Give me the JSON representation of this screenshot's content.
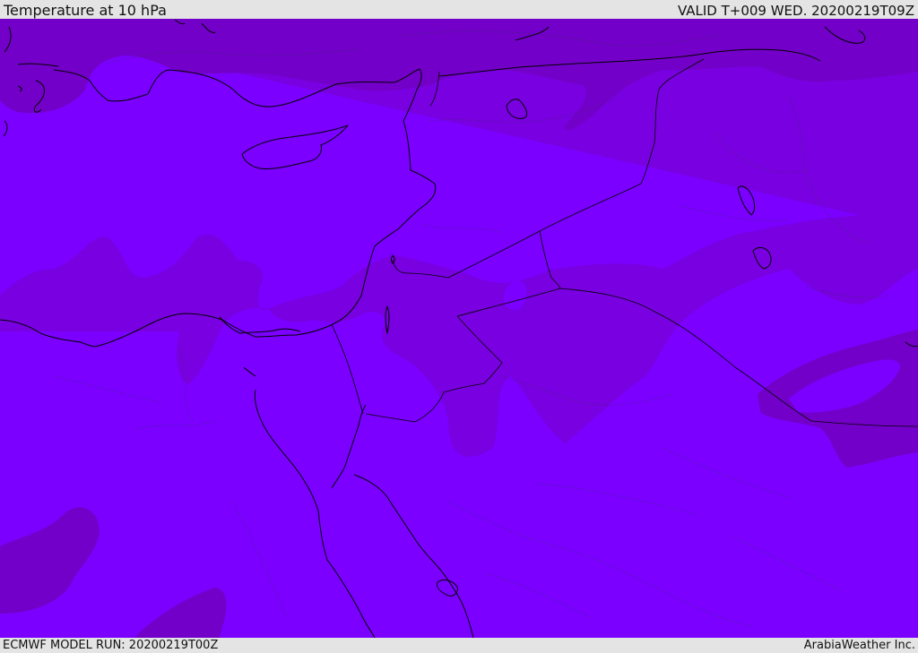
{
  "header": {
    "title": "Temperature at 10 hPa",
    "valid_time": "VALID T+009 WED. 20200219T09Z"
  },
  "footer": {
    "model_run": "ECMWF MODEL RUN: 20200219T00Z",
    "credit": "ArabiaWeather Inc."
  },
  "map": {
    "colors": {
      "dark_band": "#7300c8",
      "mid_band": "#7900e0",
      "light_band": "#7b00ff",
      "coastline": "#000000"
    }
  }
}
